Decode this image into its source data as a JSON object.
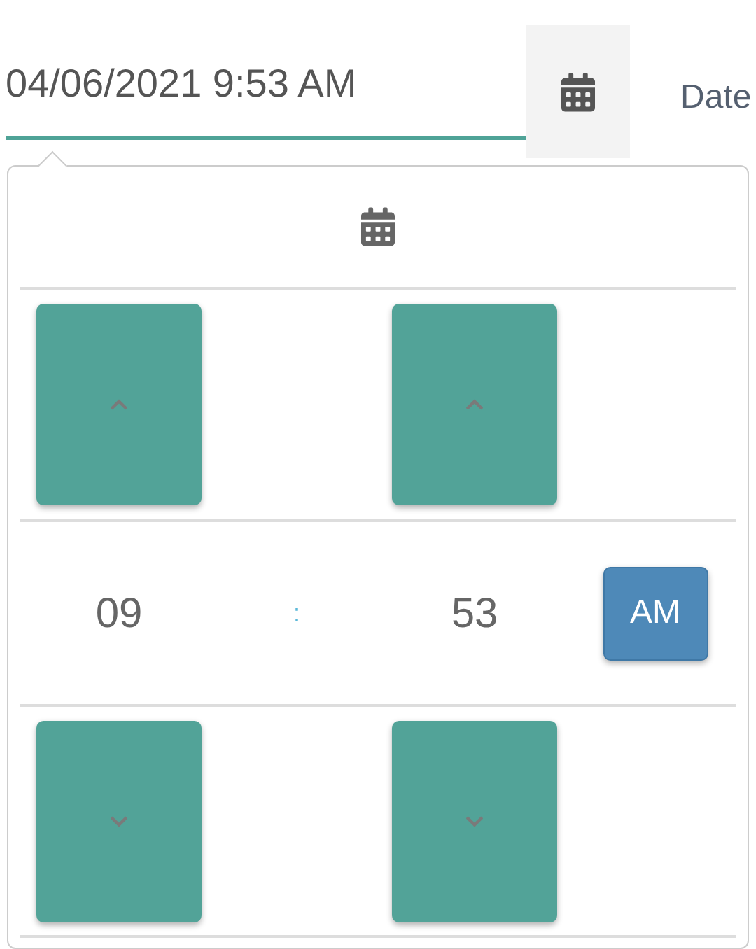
{
  "datetime_field": {
    "value": "04/06/2021 9:53 AM"
  },
  "side_label": "Date",
  "picker": {
    "hours": "09",
    "separator": ":",
    "minutes": "53",
    "period": "AM"
  }
}
